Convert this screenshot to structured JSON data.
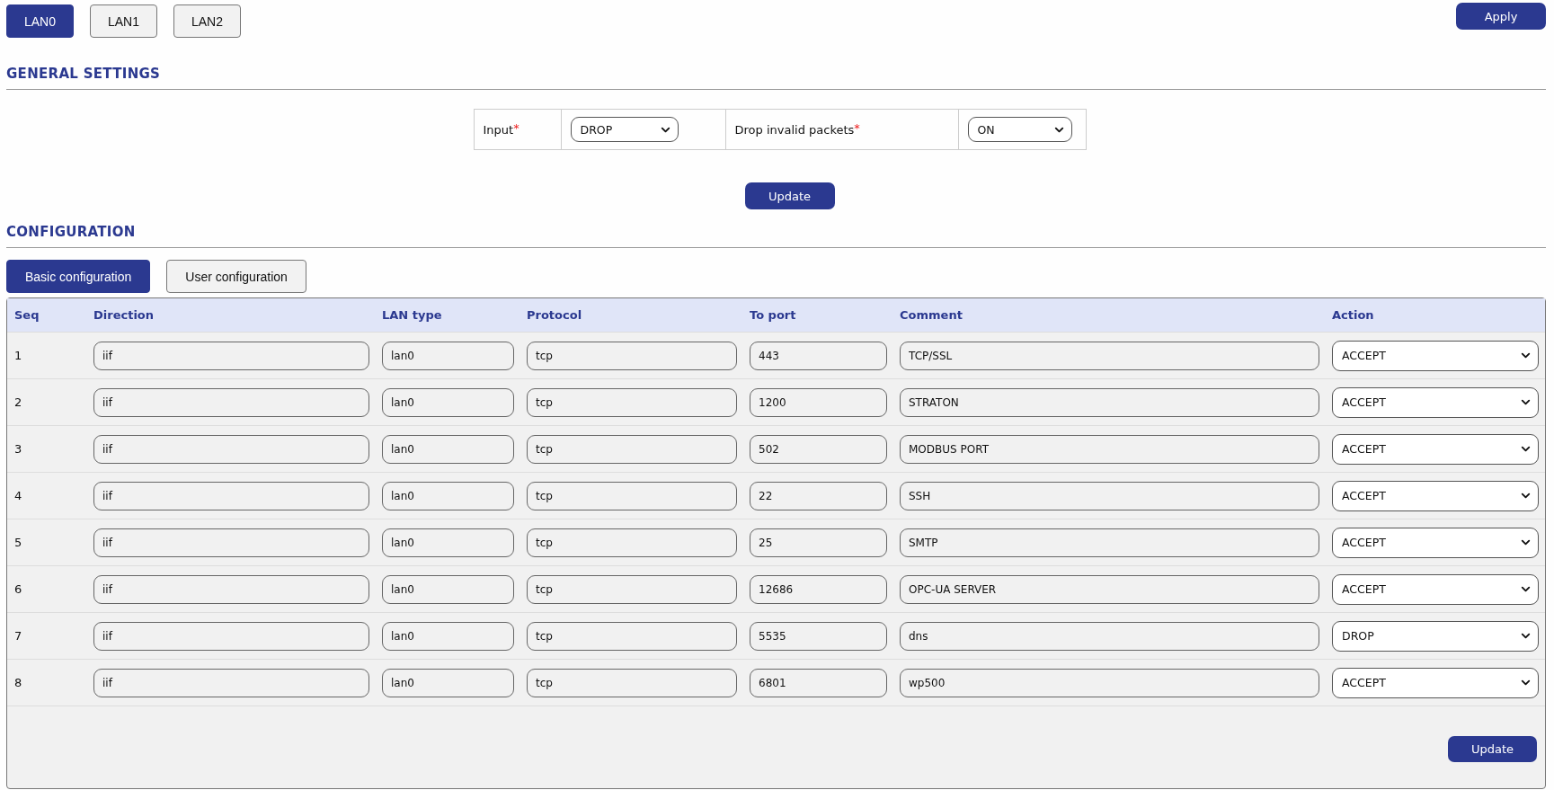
{
  "lan_tabs": [
    {
      "label": "LAN0",
      "selected": true
    },
    {
      "label": "LAN1",
      "selected": false
    },
    {
      "label": "LAN2",
      "selected": false
    }
  ],
  "apply_button": "Apply",
  "general_settings": {
    "title": "GENERAL SETTINGS",
    "fields": [
      {
        "label": "Input",
        "required_mark": "*",
        "value": "DROP"
      },
      {
        "label": "Drop invalid packets",
        "required_mark": "*",
        "value": "ON"
      }
    ],
    "update_button": "Update"
  },
  "configuration": {
    "title": "CONFIGURATION",
    "tabs": [
      {
        "label": "Basic configuration",
        "selected": true
      },
      {
        "label": "User configuration",
        "selected": false
      }
    ],
    "table": {
      "columns": [
        "Seq",
        "Direction",
        "LAN type",
        "Protocol",
        "To port",
        "Comment",
        "Action"
      ],
      "rows": [
        {
          "seq": "1",
          "direction": "iif",
          "lan_type": "lan0",
          "protocol": "tcp",
          "to_port": "443",
          "comment": "TCP/SSL",
          "action": "ACCEPT"
        },
        {
          "seq": "2",
          "direction": "iif",
          "lan_type": "lan0",
          "protocol": "tcp",
          "to_port": "1200",
          "comment": "STRATON",
          "action": "ACCEPT"
        },
        {
          "seq": "3",
          "direction": "iif",
          "lan_type": "lan0",
          "protocol": "tcp",
          "to_port": "502",
          "comment": "MODBUS PORT",
          "action": "ACCEPT"
        },
        {
          "seq": "4",
          "direction": "iif",
          "lan_type": "lan0",
          "protocol": "tcp",
          "to_port": "22",
          "comment": "SSH",
          "action": "ACCEPT"
        },
        {
          "seq": "5",
          "direction": "iif",
          "lan_type": "lan0",
          "protocol": "tcp",
          "to_port": "25",
          "comment": "SMTP",
          "action": "ACCEPT"
        },
        {
          "seq": "6",
          "direction": "iif",
          "lan_type": "lan0",
          "protocol": "tcp",
          "to_port": "12686",
          "comment": "OPC-UA SERVER",
          "action": "ACCEPT"
        },
        {
          "seq": "7",
          "direction": "iif",
          "lan_type": "lan0",
          "protocol": "tcp",
          "to_port": "5535",
          "comment": "dns",
          "action": "DROP"
        },
        {
          "seq": "8",
          "direction": "iif",
          "lan_type": "lan0",
          "protocol": "tcp",
          "to_port": "6801",
          "comment": "wp500",
          "action": "ACCEPT"
        }
      ]
    },
    "update_button": "Update"
  }
}
